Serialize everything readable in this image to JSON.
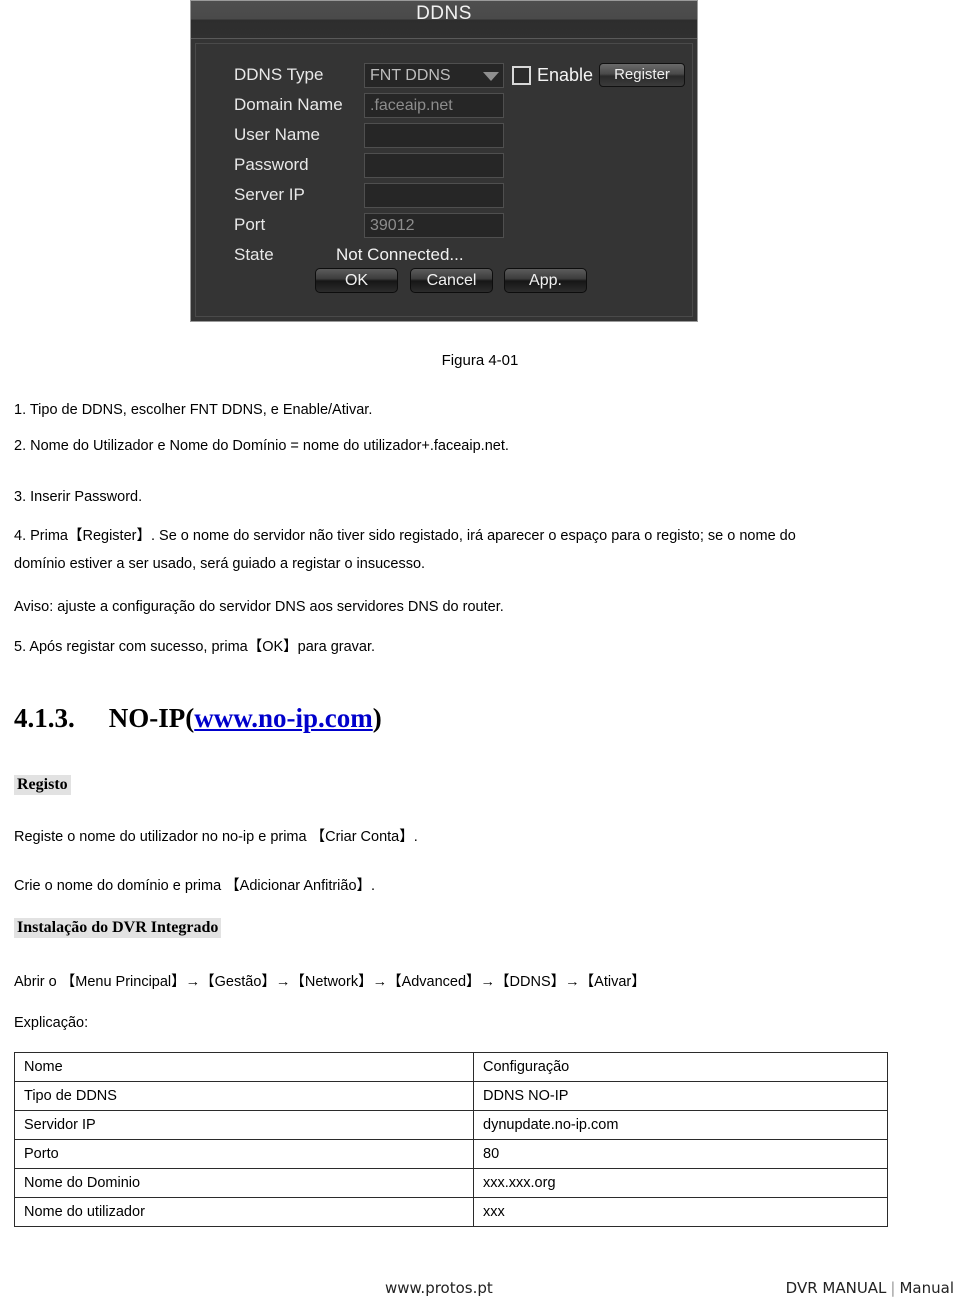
{
  "figure": {
    "dialog": {
      "title": "DDNS",
      "fields": [
        {
          "label": "DDNS Type",
          "value": "FNT DDNS",
          "type": "select"
        },
        {
          "label": "Domain Name",
          "value": ".faceaip.net",
          "type": "text"
        },
        {
          "label": "User Name",
          "value": "",
          "type": "text"
        },
        {
          "label": "Password",
          "value": "",
          "type": "password"
        },
        {
          "label": "Server IP",
          "value": "",
          "type": "text"
        },
        {
          "label": "Port",
          "value": "39012",
          "type": "text"
        },
        {
          "label": "State",
          "value": "Not Connected...",
          "type": "status"
        }
      ],
      "enable_label": "Enable",
      "enable_checked": false,
      "register_label": "Register",
      "buttons": {
        "ok": "OK",
        "cancel": "Cancel",
        "apply": "App."
      }
    },
    "caption": "Figura 4-01"
  },
  "steps": [
    "1. Tipo de DDNS, escolher FNT DDNS, e Enable/Ativar.",
    "2. Nome do Utilizador e Nome do Domínio = nome do utilizador+.faceaip.net.",
    "3. Inserir Password."
  ],
  "step4_line1": "4. Prima【Register】. Se o nome do servidor não tiver sido registado, irá aparecer o espaço para o registo; se o nome do",
  "step4_line2": "domínio estiver a ser usado, será guiado a registar o insucesso.",
  "notice": "Aviso: ajuste a configuração do servidor DNS aos servidores DNS do router.",
  "step5": "5. Após registar com sucesso, prima【OK】para gravar.",
  "section": {
    "number": "4.1.3.",
    "title_prefix": "NO-IP(",
    "link": "www.no-ip.com",
    "title_suffix": ")"
  },
  "registo": {
    "heading": "Registo",
    "line1": "Registe o nome do utilizador no no-ip e prima 【Criar Conta】.",
    "line2": "Crie o nome do domínio e prima 【Adicionar Anfitrião】."
  },
  "instalacao": {
    "heading": "Instalação do DVR Integrado",
    "path": "Abrir o 【Menu Principal】→【Gestão】→【Network】→【Advanced】→【DDNS】→【Ativar】",
    "explicacao_label": "Explicação:"
  },
  "table": {
    "headers": [
      "Nome",
      "Configuração"
    ],
    "rows": [
      [
        "Tipo de DDNS",
        "DDNS NO-IP"
      ],
      [
        "Servidor IP",
        "dynupdate.no-ip.com"
      ],
      [
        "Porto",
        "80"
      ],
      [
        "Nome do Dominio",
        "xxx.xxx.org"
      ],
      [
        "Nome do utilizador",
        "xxx"
      ]
    ]
  },
  "footer": {
    "left": "www.protos.pt",
    "right_main": "DVR MANUAL",
    "separator": "|",
    "right_sub": "Manual"
  }
}
